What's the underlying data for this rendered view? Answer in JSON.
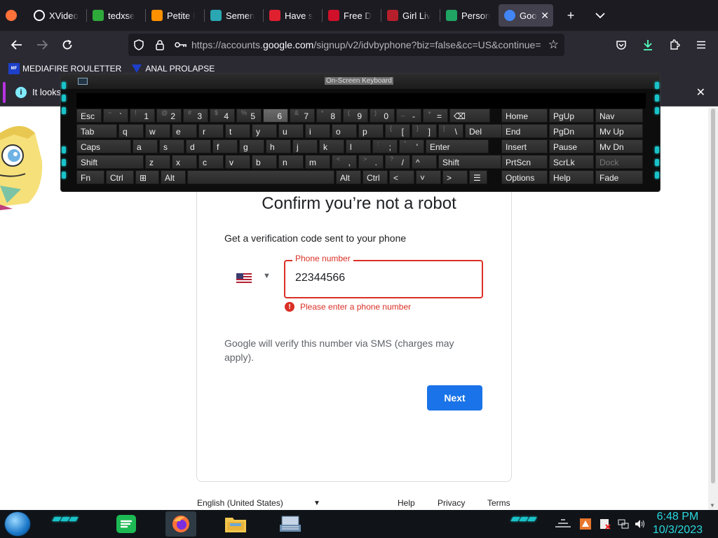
{
  "browser": {
    "tabs": [
      {
        "title": "",
        "icon": "firefox-icon",
        "color": "#ff7139"
      },
      {
        "title": "XVideo",
        "icon": "circle-icon",
        "color": "#ffffff"
      },
      {
        "title": "tedxse",
        "icon": "fx-icon",
        "color": "#2eaa3a"
      },
      {
        "title": "Petite I",
        "icon": "ph-icon",
        "color": "#ff9000"
      },
      {
        "title": "Semen",
        "icon": "s-icon",
        "color": "#2aa7b3"
      },
      {
        "title": "Have s",
        "icon": "lips-icon",
        "color": "#e0202f"
      },
      {
        "title": "Free D",
        "icon": "e-icon",
        "color": "#d0102a"
      },
      {
        "title": "Girl Liv",
        "icon": "j-icon",
        "color": "#b51f2b"
      },
      {
        "title": "Person",
        "icon": "drive-icon",
        "color": "#1fa463"
      },
      {
        "title": "Goo",
        "icon": "google-icon",
        "color": "#4285f4"
      }
    ],
    "active_tab_close": "✕",
    "new_tab": "+",
    "list_tabs": "⌄",
    "url_prefix": "https://accounts.",
    "url_domain": "google.com",
    "url_suffix": "/signup/v2/idvbyphone?biz=false&cc=US&continue=",
    "bookmarks": [
      {
        "label": "MEDIAFIRE ROULETTER",
        "icon": "mediafire-icon"
      },
      {
        "label": "ANAL PROLAPSE",
        "icon": "bookmark-icon"
      }
    ],
    "notice_text": "It looks"
  },
  "keyboard": {
    "title": "On-Screen Keyboard",
    "rows": [
      [
        [
          "Esc",
          "",
          ""
        ],
        [
          "",
          "~",
          "`"
        ],
        [
          "",
          "!",
          "1"
        ],
        [
          "",
          "@",
          "2"
        ],
        [
          "",
          "#",
          "3"
        ],
        [
          "",
          "$",
          "4"
        ],
        [
          "",
          "%",
          "5"
        ],
        [
          "",
          "^",
          "6"
        ],
        [
          "",
          "&",
          "7"
        ],
        [
          "",
          "*",
          "8"
        ],
        [
          "",
          "(",
          "9"
        ],
        [
          "",
          ")",
          "0"
        ],
        [
          "",
          "_",
          "-"
        ],
        [
          "",
          "+",
          "="
        ],
        [
          "⌫",
          "",
          ""
        ],
        [
          "Home",
          "",
          ""
        ],
        [
          "PgUp",
          "",
          ""
        ],
        [
          "Nav",
          "",
          ""
        ]
      ],
      [
        [
          "Tab",
          "",
          ""
        ],
        [
          "q",
          "",
          ""
        ],
        [
          "w",
          "",
          ""
        ],
        [
          "e",
          "",
          ""
        ],
        [
          "r",
          "",
          ""
        ],
        [
          "t",
          "",
          ""
        ],
        [
          "y",
          "",
          ""
        ],
        [
          "u",
          "",
          ""
        ],
        [
          "i",
          "",
          ""
        ],
        [
          "o",
          "",
          ""
        ],
        [
          "p",
          "",
          ""
        ],
        [
          "",
          "{",
          "["
        ],
        [
          "",
          "}",
          "]"
        ],
        [
          "",
          "|",
          "\\"
        ],
        [
          "Del",
          "",
          ""
        ],
        [
          "End",
          "",
          ""
        ],
        [
          "PgDn",
          "",
          ""
        ],
        [
          "Mv Up",
          "",
          ""
        ]
      ],
      [
        [
          "Caps",
          "",
          ""
        ],
        [
          "a",
          "",
          ""
        ],
        [
          "s",
          "",
          ""
        ],
        [
          "d",
          "",
          ""
        ],
        [
          "f",
          "",
          ""
        ],
        [
          "g",
          "",
          ""
        ],
        [
          "h",
          "",
          ""
        ],
        [
          "j",
          "",
          ""
        ],
        [
          "k",
          "",
          ""
        ],
        [
          "l",
          "",
          ""
        ],
        [
          "",
          ":",
          ";"
        ],
        [
          "",
          "\"",
          "'"
        ],
        [
          "Enter",
          "",
          ""
        ],
        [
          "Insert",
          "",
          ""
        ],
        [
          "Pause",
          "",
          ""
        ],
        [
          "Mv Dn",
          "",
          ""
        ]
      ],
      [
        [
          "Shift",
          "",
          ""
        ],
        [
          "z",
          "",
          ""
        ],
        [
          "x",
          "",
          ""
        ],
        [
          "c",
          "",
          ""
        ],
        [
          "v",
          "",
          ""
        ],
        [
          "b",
          "",
          ""
        ],
        [
          "n",
          "",
          ""
        ],
        [
          "m",
          "",
          ""
        ],
        [
          "",
          "<",
          ","
        ],
        [
          "",
          ">",
          "."
        ],
        [
          "",
          "?",
          "/"
        ],
        [
          "^",
          "",
          ""
        ],
        [
          "Shift",
          "",
          ""
        ],
        [
          "PrtScn",
          "",
          ""
        ],
        [
          "ScrLk",
          "",
          ""
        ],
        [
          "Dock",
          "",
          ""
        ]
      ],
      [
        [
          "Fn",
          "",
          ""
        ],
        [
          "Ctrl",
          "",
          ""
        ],
        [
          "⊞",
          "",
          ""
        ],
        [
          "Alt",
          "",
          ""
        ],
        [
          "",
          "",
          ""
        ],
        [
          "Alt",
          "",
          ""
        ],
        [
          "Ctrl",
          "",
          ""
        ],
        [
          "<",
          "",
          ""
        ],
        [
          "˅",
          "",
          ""
        ],
        [
          ">",
          "",
          ""
        ],
        [
          "☰",
          "",
          ""
        ],
        [
          "Options",
          "",
          ""
        ],
        [
          "Help",
          "",
          ""
        ],
        [
          "Fade",
          "",
          ""
        ]
      ]
    ]
  },
  "page": {
    "title": "Confirm you’re not a robot",
    "subtitle": "Get a verification code sent to your phone",
    "country_flag": "us-flag-icon",
    "phone_label": "Phone number",
    "phone_value": "22344566",
    "error_text": "Please enter a phone number",
    "sms_note": "Google will verify this number via SMS (charges may apply).",
    "next_label": "Next",
    "footer_language": "English (United States)",
    "footer_links": [
      "Help",
      "Privacy",
      "Terms"
    ]
  },
  "taskbar": {
    "apps": [
      "spotify-icon",
      "firefox-icon",
      "file-explorer-icon",
      "on-screen-keyboard-icon"
    ],
    "time": "6:48 PM",
    "date": "10/3/2023"
  },
  "colors": {
    "accent": "#1a73e8",
    "error": "#d93025",
    "chrome_dark": "#1c1b22",
    "neon": "#19c3c9"
  }
}
